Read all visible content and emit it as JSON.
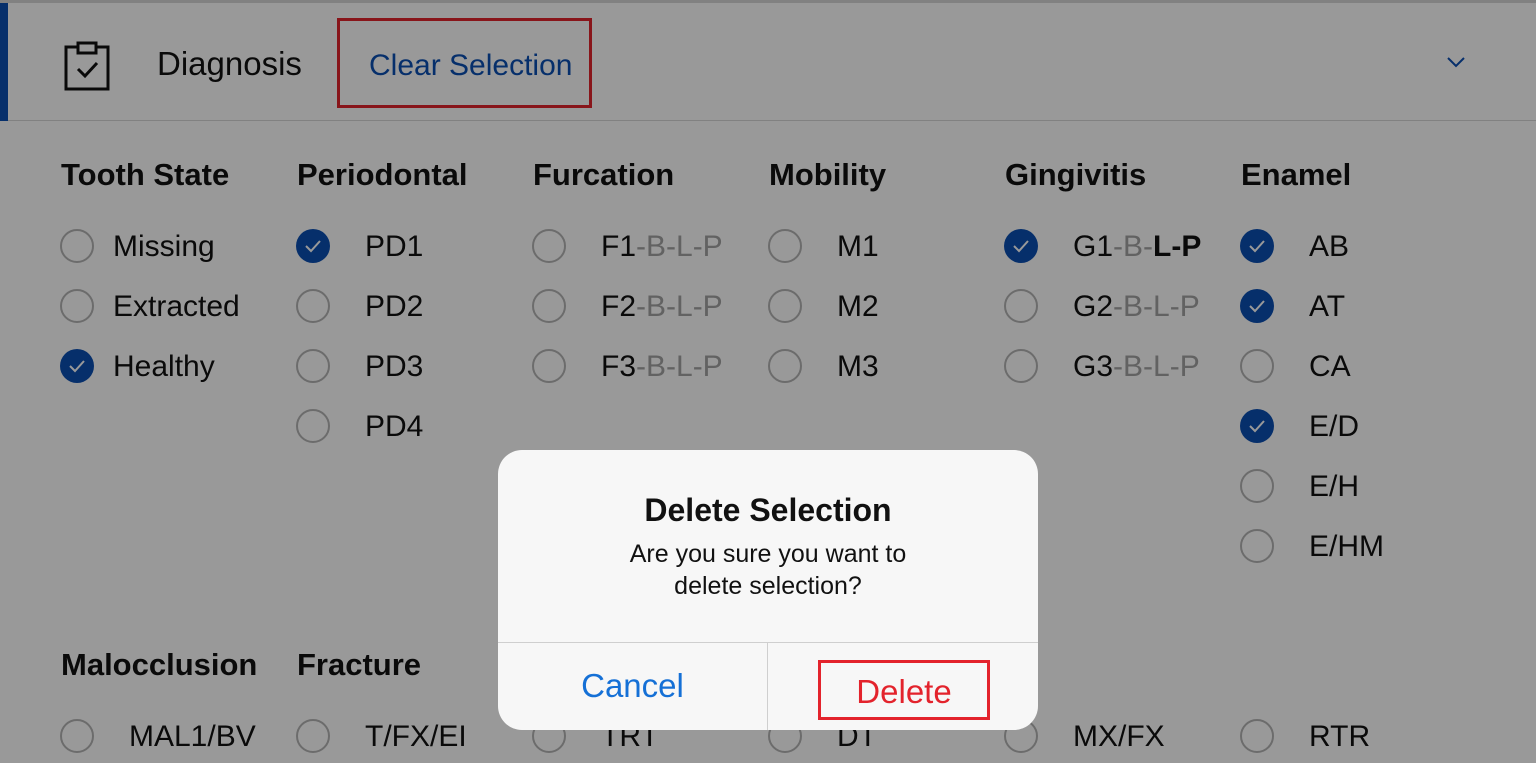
{
  "header": {
    "title": "Diagnosis",
    "clear_label": "Clear Selection"
  },
  "columns": [
    {
      "title": "Tooth State",
      "options": [
        {
          "label": "Missing",
          "checked": false
        },
        {
          "label": "Extracted",
          "checked": false
        },
        {
          "label": "Healthy",
          "checked": true
        }
      ]
    },
    {
      "title": "Periodontal",
      "options": [
        {
          "label": "PD1",
          "checked": true
        },
        {
          "label": "PD2",
          "checked": false
        },
        {
          "label": "PD3",
          "checked": false
        },
        {
          "label": "PD4",
          "checked": false
        }
      ]
    },
    {
      "title": "Furcation",
      "options": [
        {
          "label": "F1",
          "suffix": "-B-L-P",
          "checked": false
        },
        {
          "label": "F2",
          "suffix": "-B-L-P",
          "checked": false
        },
        {
          "label": "F3",
          "suffix": "-B-L-P",
          "checked": false
        }
      ]
    },
    {
      "title": "Mobility",
      "options": [
        {
          "label": "M1",
          "checked": false
        },
        {
          "label": "M2",
          "checked": false
        },
        {
          "label": "M3",
          "checked": false
        }
      ]
    },
    {
      "title": "Gingivitis",
      "options": [
        {
          "label": "G1",
          "suffix_gray": "-B-",
          "suffix_bold": "L-P",
          "checked": true
        },
        {
          "label": "G2",
          "suffix": "-B-L-P",
          "checked": false
        },
        {
          "label": "G3",
          "suffix": "-B-L-P",
          "checked": false
        }
      ]
    },
    {
      "title": "Enamel",
      "options": [
        {
          "label": "AB",
          "checked": true
        },
        {
          "label": "AT",
          "checked": true
        },
        {
          "label": "CA",
          "checked": false
        },
        {
          "label": "E/D",
          "checked": true
        },
        {
          "label": "E/H",
          "checked": false
        },
        {
          "label": "E/HM",
          "checked": false
        }
      ]
    }
  ],
  "second_row": {
    "titles": [
      "Malocclusion",
      "Fracture"
    ],
    "options": [
      "MAL1/BV",
      "T/FX/EI",
      "TRT",
      "DT",
      "MX/FX",
      "RTR"
    ]
  },
  "dialog": {
    "title": "Delete Selection",
    "message": "Are you sure you want to delete selection?",
    "cancel_label": "Cancel",
    "delete_label": "Delete"
  },
  "colors": {
    "accent": "#0a4fb3",
    "destructive": "#e3232c",
    "ios_blue": "#1570d6"
  }
}
